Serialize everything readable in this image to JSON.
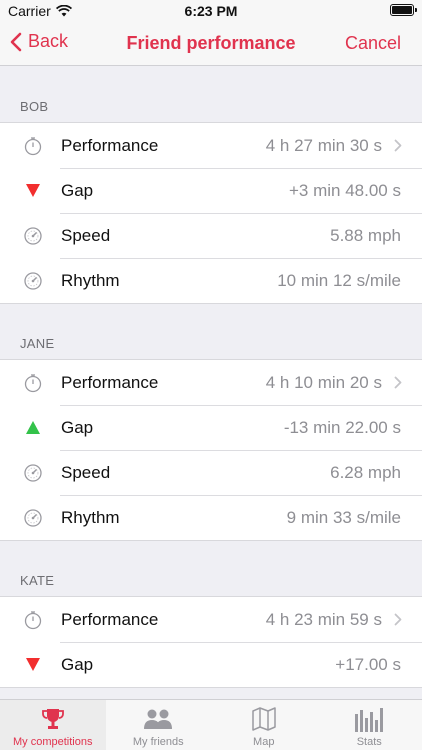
{
  "status_bar": {
    "carrier": "Carrier",
    "time": "6:23 PM"
  },
  "nav": {
    "back_label": "Back",
    "title": "Friend performance",
    "cancel_label": "Cancel"
  },
  "accent_color": "#e0334e",
  "sections": [
    {
      "header": "BOB",
      "rows": [
        {
          "icon": "stopwatch-icon",
          "label": "Performance",
          "value": "4 h 27 min 30 s",
          "chevron": true
        },
        {
          "icon": "triangle-down-red-icon",
          "label": "Gap",
          "value": "+3 min 48.00 s"
        },
        {
          "icon": "speedometer-icon",
          "label": "Speed",
          "value": "5.88 mph"
        },
        {
          "icon": "speedometer-icon",
          "label": "Rhythm",
          "value": "10 min 12 s/mile"
        }
      ]
    },
    {
      "header": "JANE",
      "rows": [
        {
          "icon": "stopwatch-icon",
          "label": "Performance",
          "value": "4 h 10 min 20 s",
          "chevron": true
        },
        {
          "icon": "triangle-up-green-icon",
          "label": "Gap",
          "value": "-13 min 22.00 s"
        },
        {
          "icon": "speedometer-icon",
          "label": "Speed",
          "value": "6.28 mph"
        },
        {
          "icon": "speedometer-icon",
          "label": "Rhythm",
          "value": "9 min 33 s/mile"
        }
      ]
    },
    {
      "header": "KATE",
      "rows": [
        {
          "icon": "stopwatch-icon",
          "label": "Performance",
          "value": "4 h 23 min 59 s",
          "chevron": true
        },
        {
          "icon": "triangle-down-red-icon",
          "label": "Gap",
          "value": "+17.00 s"
        }
      ]
    }
  ],
  "tabs": [
    {
      "label": "My competitions",
      "icon": "trophy-icon",
      "active": true
    },
    {
      "label": "My friends",
      "icon": "people-icon"
    },
    {
      "label": "Map",
      "icon": "map-icon"
    },
    {
      "label": "Stats",
      "icon": "bar-chart-icon"
    }
  ]
}
